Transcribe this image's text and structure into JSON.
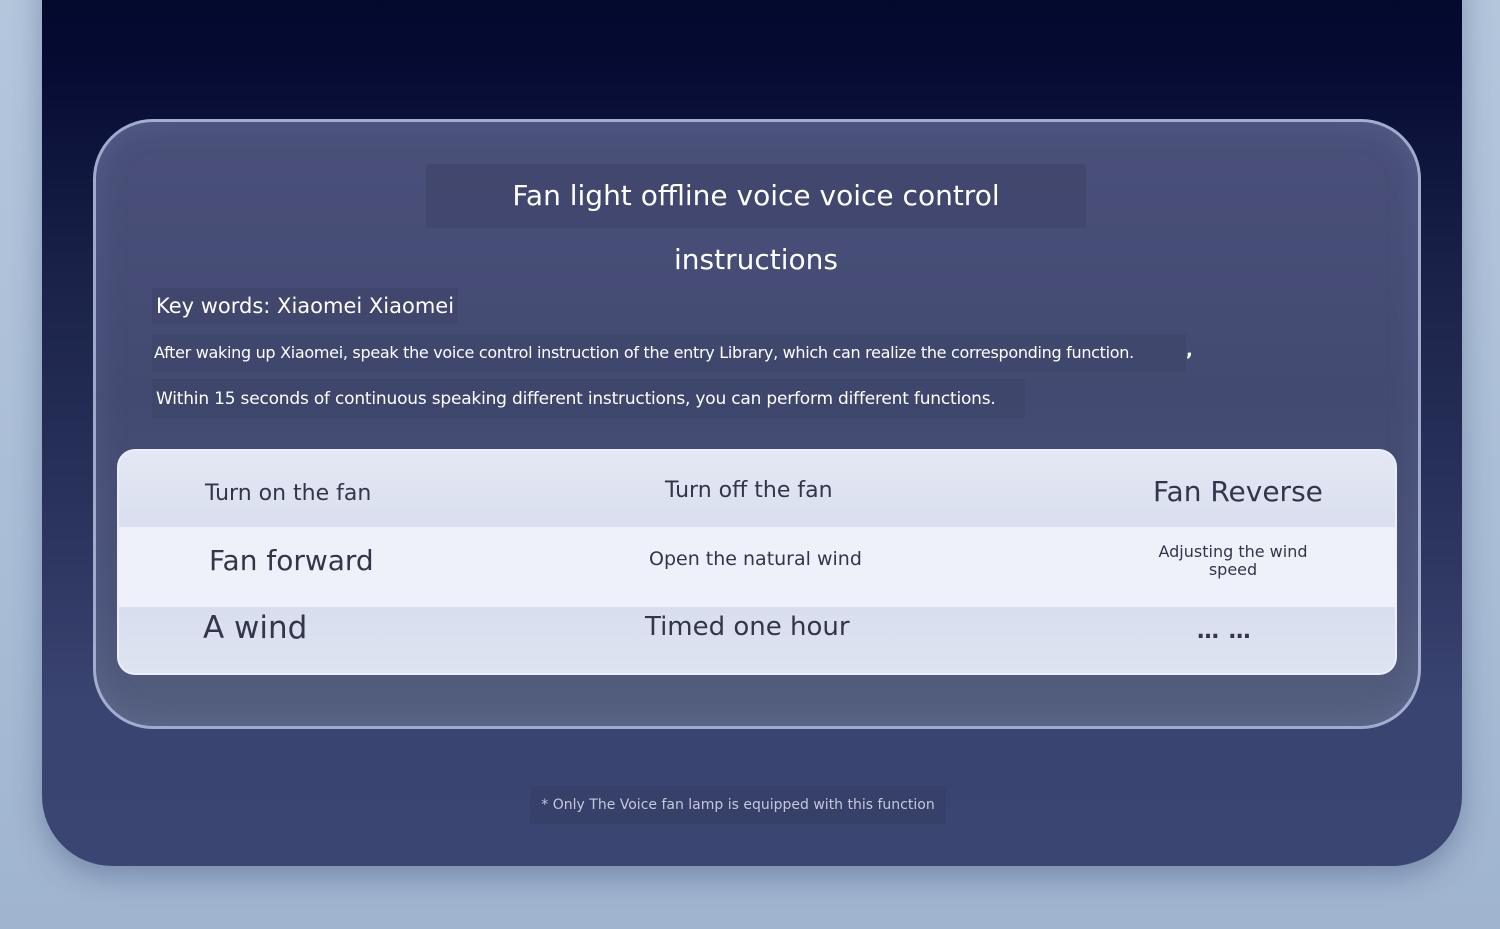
{
  "header": {
    "title": "Fan light offline voice voice control instructions"
  },
  "intro": {
    "keywords": "Key words: Xiaomei Xiaomei",
    "line1": "After waking up Xiaomei, speak the voice control instruction of the entry Library, which can realize the corresponding function.",
    "line1_suffix": ",",
    "line2": "Within 15 seconds of continuous speaking different instructions, you can perform different functions."
  },
  "commands": {
    "row1": [
      "Turn on the fan",
      "Turn off the fan",
      "Fan Reverse"
    ],
    "row2": [
      "Fan forward",
      "Open the natural wind",
      "Adjusting the wind speed"
    ],
    "row3": [
      "A wind",
      "Timed one hour",
      "… …"
    ]
  },
  "footer": {
    "note": "* Only The Voice fan lamp is equipped with this function"
  },
  "colors": {
    "panel_dark": "#060b33",
    "card_bg": "#454c74",
    "table_bg": "#dfe4f2",
    "text_dark": "#33364a",
    "text_light": "#ffffff"
  }
}
